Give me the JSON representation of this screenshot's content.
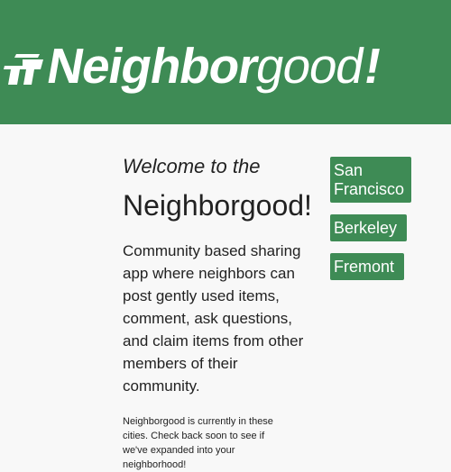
{
  "header": {
    "logo_main": "Neighbor",
    "logo_secondary": "good",
    "logo_mark": "!",
    "logo_icon": "home-icon",
    "bg_color": "#3e8b55"
  },
  "intro": {
    "welcome": "Welcome to the",
    "title": "Neighborgood!",
    "description": "Community based sharing app where neighbors can post gently used items, comment, ask questions, and claim items from other members of their community.",
    "note": "Neighborgood is currently in these cities. Check back soon to see if we've expanded into your neighborhood!"
  },
  "cities": [
    {
      "label": "San Francisco"
    },
    {
      "label": "Berkeley"
    },
    {
      "label": "Fremont"
    }
  ],
  "colors": {
    "accent": "#3e8b55",
    "text": "#222222",
    "background": "#f8f8f8"
  }
}
